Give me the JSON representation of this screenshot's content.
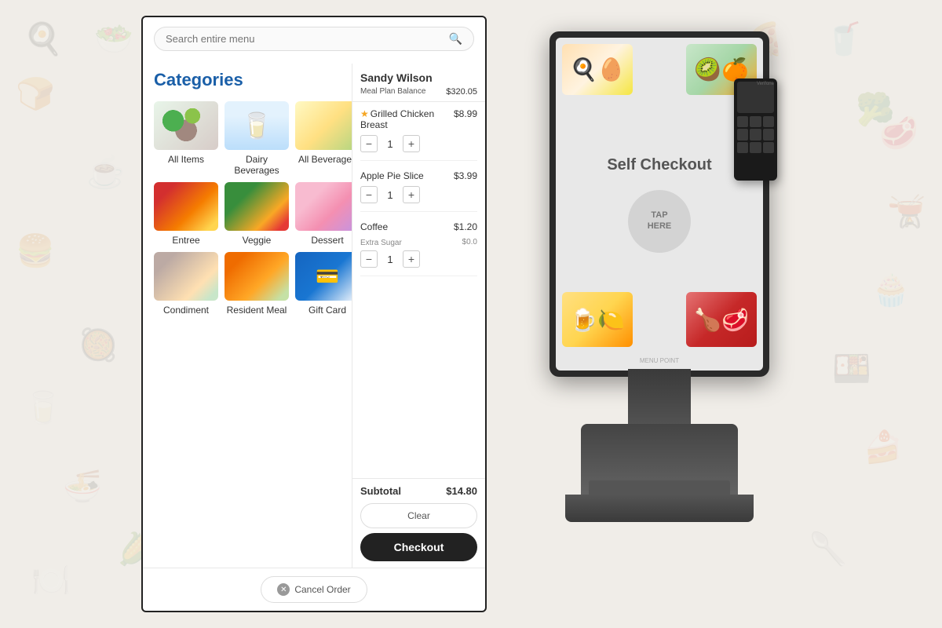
{
  "background": {
    "icons": [
      "🍳",
      "🥗",
      "🍞",
      "🥤",
      "🍔",
      "🍕",
      "🥘",
      "🍜",
      "🧁",
      "🥩",
      "☕",
      "🥛",
      "🍰",
      "🥄",
      "🍽️",
      "🌽",
      "🥦",
      "🥩",
      "🍱",
      "🫕"
    ]
  },
  "pos": {
    "search_placeholder": "Search entire menu",
    "categories_title": "Categories",
    "categories": [
      {
        "id": "all-items",
        "label": "All Items"
      },
      {
        "id": "dairy",
        "label": "Dairy Beverages"
      },
      {
        "id": "beverages",
        "label": "All Beverages"
      },
      {
        "id": "entree",
        "label": "Entree"
      },
      {
        "id": "veggie",
        "label": "Veggie"
      },
      {
        "id": "dessert",
        "label": "Dessert"
      },
      {
        "id": "condiment",
        "label": "Condiment"
      },
      {
        "id": "resident-meal",
        "label": "Resident Meal"
      },
      {
        "id": "gift-card",
        "label": "Gift Card"
      }
    ],
    "cancel_button": "Cancel Order"
  },
  "order": {
    "user_name": "Sandy Wilson",
    "meal_plan_label": "Meal Plan Balance",
    "meal_plan_balance": "$320.05",
    "items": [
      {
        "id": "grilled-chicken",
        "name": "Grilled Chicken Breast",
        "price": "$8.99",
        "has_star": true,
        "qty": 1,
        "note": null,
        "note_price": null
      },
      {
        "id": "apple-pie",
        "name": "Apple Pie Slice",
        "price": "$3.99",
        "has_star": false,
        "qty": 1,
        "note": null,
        "note_price": null
      },
      {
        "id": "coffee",
        "name": "Coffee",
        "price": "$1.20",
        "has_star": false,
        "qty": 1,
        "note": "Extra Sugar",
        "note_price": "$0.0"
      }
    ],
    "subtotal_label": "Subtotal",
    "subtotal_amount": "$14.80",
    "clear_button": "Clear",
    "checkout_button": "Checkout"
  },
  "kiosk": {
    "self_checkout_text": "Self Checkout",
    "tap_here_line1": "TAP",
    "tap_here_line2": "HERE",
    "logo_text": "MENU POINT",
    "card_reader_brand": "Verifone"
  }
}
